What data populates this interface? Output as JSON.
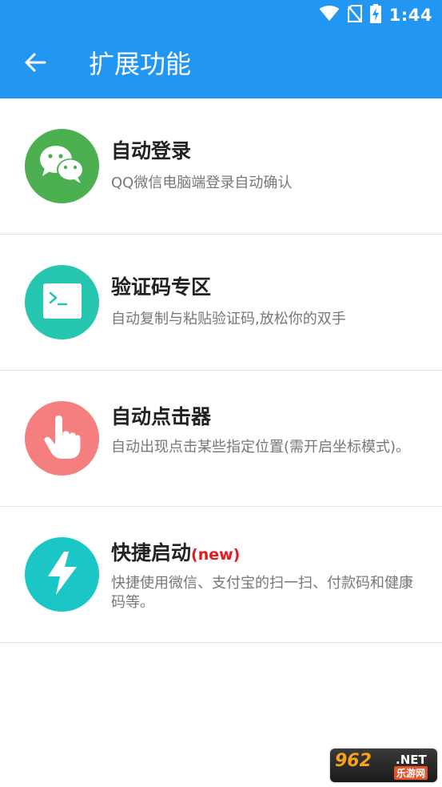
{
  "status_bar": {
    "time": "1:44",
    "icons": [
      "wifi-icon",
      "no-sim-icon",
      "battery-charging-icon"
    ]
  },
  "app_bar": {
    "title": "扩展功能",
    "back_icon": "arrow-left-icon"
  },
  "items": [
    {
      "title": "自动登录",
      "new_badge": "",
      "description": "QQ微信电脑端登录自动确认",
      "icon": "wechat-icon",
      "color": "#4CAF50"
    },
    {
      "title": "验证码专区",
      "new_badge": "",
      "description": "自动复制与粘贴验证码,放松你的双手",
      "icon": "terminal-icon",
      "color": "#26C6B0"
    },
    {
      "title": "自动点击器",
      "new_badge": "",
      "description": "自动出现点击某些指定位置(需开启坐标模式)。",
      "icon": "hand-pointer-icon",
      "color": "#F57F7F"
    },
    {
      "title": "快捷启动",
      "new_badge": "(new)",
      "description": "快捷使用微信、支付宝的扫一扫、付款码和健康码等。",
      "icon": "lightning-icon",
      "color": "#1BC6C6"
    }
  ],
  "watermark": {
    "number": "962",
    "domain": ".NET",
    "brand": "乐游网"
  }
}
